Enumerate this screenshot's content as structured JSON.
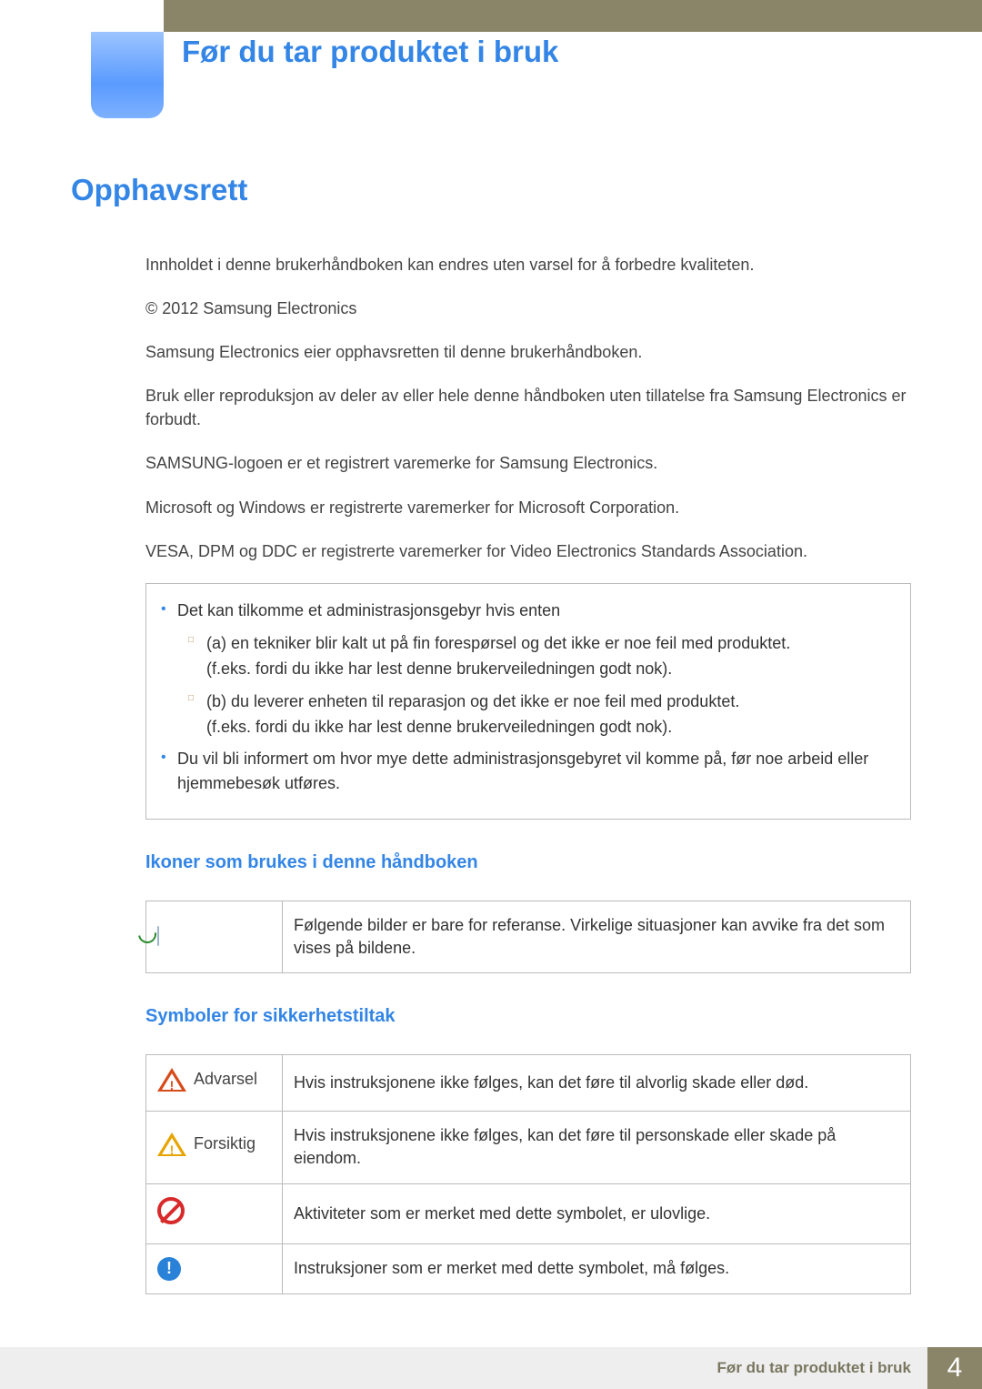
{
  "chapter_title": "Før du tar produktet i bruk",
  "section_title": "Opphavsrett",
  "intro_paragraphs": [
    "Innholdet i denne brukerhåndboken kan endres uten varsel for å forbedre kvaliteten.",
    "© 2012 Samsung Electronics",
    "Samsung Electronics eier opphavsretten til denne brukerhåndboken.",
    "Bruk eller reproduksjon av deler av eller hele denne håndboken uten tillatelse fra Samsung Electronics er forbudt.",
    "SAMSUNG-logoen er et registrert varemerke for Samsung Electronics.",
    "Microsoft og Windows er registrerte varemerker for Microsoft Corporation.",
    "VESA, DPM og DDC er registrerte varemerker for Video Electronics Standards Association."
  ],
  "note_box": {
    "bullet1": "Det kan tilkomme et administrasjonsgebyr hvis enten",
    "sub_a": "(a) en tekniker blir kalt ut på fin forespørsel og det ikke er noe feil med produktet.",
    "sub_a2": "(f.eks. fordi du ikke har lest denne brukerveiledningen godt nok).",
    "sub_b": "(b) du leverer enheten til reparasjon og det ikke er noe feil med produktet.",
    "sub_b2": "(f.eks. fordi du ikke har lest denne brukerveiledningen godt nok).",
    "bullet2": "Du vil bli informert om hvor mye dette administrasjonsgebyret vil komme på, før noe arbeid eller hjemmebesøk utføres."
  },
  "subsection_icons": "Ikoner som brukes i denne håndboken",
  "icon_row_text": "Følgende bilder er bare for referanse. Virkelige situasjoner kan avvike fra det som vises på bildene.",
  "subsection_safety": "Symboler for sikkerhetstiltak",
  "safety": {
    "warning_label": "Advarsel",
    "warning_text": "Hvis instruksjonene ikke følges, kan det føre til alvorlig skade eller død.",
    "caution_label": "Forsiktig",
    "caution_text": "Hvis instruksjonene ikke følges, kan det føre til personskade eller skade på eiendom.",
    "prohibited_text": "Aktiviteter som er merket med dette symbolet, er ulovlige.",
    "mandatory_text": "Instruksjoner som er merket med dette symbolet, må følges."
  },
  "footer": {
    "text": "Før du tar produktet i bruk",
    "page": "4"
  }
}
